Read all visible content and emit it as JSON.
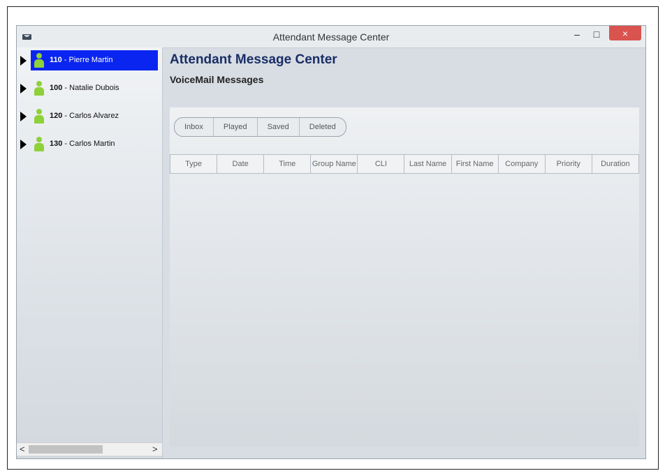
{
  "window": {
    "title": "Attendant Message Center",
    "minimize": "–",
    "maximize": "□",
    "close": "×"
  },
  "sidebar": {
    "items": [
      {
        "ext": "110",
        "sep": " - ",
        "name": "Pierre Martin",
        "selected": true
      },
      {
        "ext": "100",
        "sep": " - ",
        "name": "Natalie Dubois",
        "selected": false
      },
      {
        "ext": "120",
        "sep": " - ",
        "name": "Carlos Alvarez",
        "selected": false
      },
      {
        "ext": "130",
        "sep": " - ",
        "name": "Carlos Martin",
        "selected": false
      }
    ],
    "scroll_left": "<",
    "scroll_right": ">"
  },
  "main": {
    "title": "Attendant Message Center",
    "subtitle": "VoiceMail Messages",
    "tabs": [
      "Inbox",
      "Played",
      "Saved",
      "Deleted"
    ],
    "columns": [
      "Type",
      "Date",
      "Time",
      "Group Name",
      "CLI",
      "Last Name",
      "First Name",
      "Company",
      "Priority",
      "Duration"
    ]
  },
  "colors": {
    "selection": "#0a25f0",
    "title_blue": "#1a2e66",
    "person_green": "#8ed13a",
    "close_red": "#d9534f"
  }
}
